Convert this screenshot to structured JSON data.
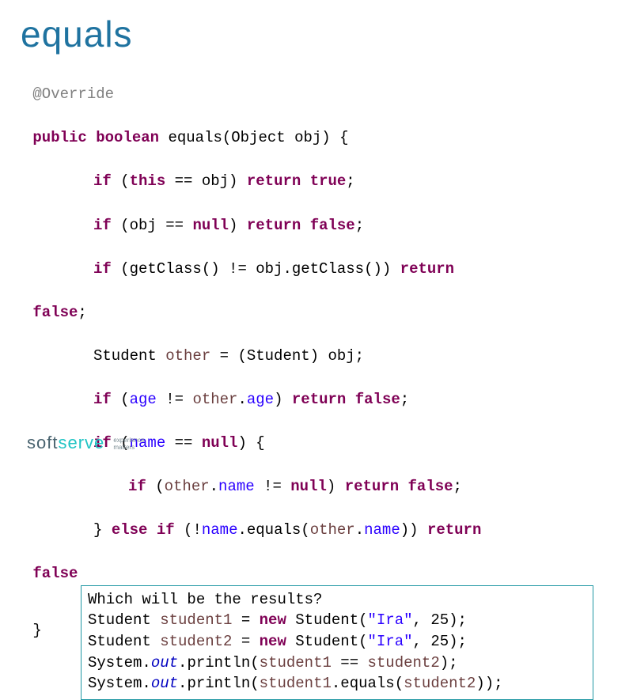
{
  "title": "equals",
  "code": {
    "ann": "@Override",
    "l1a": "public",
    "l1b": "boolean",
    "l1c": "equals(Object obj) {",
    "l2a": "if",
    "l2b": "(",
    "l2c": "this",
    "l2d": " == obj) ",
    "l2e": "return",
    "l2f": "true",
    "l2g": ";",
    "l3a": "if",
    "l3b": " (obj == ",
    "l3c": "null",
    "l3d": ") ",
    "l3e": "return",
    "l3f": "false",
    "l3g": ";",
    "l4a": "if",
    "l4b": " (getClass() != obj.getClass()) ",
    "l4c": "return",
    "l5a": "false",
    "l5b": ";",
    "l6a": "Student ",
    "l6b": "other",
    "l6c": " = (Student) obj;",
    "l7a": "if",
    "l7b": " (",
    "l7c": "age",
    "l7d": " != ",
    "l7e": "other",
    "l7f": ".",
    "l7g": "age",
    "l7h": ") ",
    "l7i": "return",
    "l7j": "false",
    "l7k": ";",
    "l8a": "if",
    "l8b": " (",
    "l8c": "name",
    "l8d": " == ",
    "l8e": "null",
    "l8f": ") {",
    "l9a": "if",
    "l9b": " (",
    "l9c": "other",
    "l9d": ".",
    "l9e": "name",
    "l9f": " != ",
    "l9g": "null",
    "l9h": ") ",
    "l9i": "return",
    "l9j": "false",
    "l9k": ";",
    "l10a": "} ",
    "l10b": "else",
    "l10c": " ",
    "l10d": "if",
    "l10e": " (!",
    "l10f": "name",
    "l10g": ".equals(",
    "l10h": "other",
    "l10i": ".",
    "l10j": "name",
    "l10k": ")) ",
    "l10l": "return",
    "l11a": "false",
    "l12a": "}"
  },
  "question": {
    "q": "Which will be the results?",
    "r1a": "Student ",
    "r1b": "student1",
    "r1c": " = ",
    "r1d": "new",
    "r1e": " Student(",
    "r1f": "\"Ira\"",
    "r1g": ", 25);",
    "r2a": "Student ",
    "r2b": "student2",
    "r2c": " = ",
    "r2d": "new",
    "r2e": " Student(",
    "r2f": "\"Ira\"",
    "r2g": ", 25);",
    "r3a": "System.",
    "r3b": "out",
    "r3c": ".println(",
    "r3d": "student1",
    "r3e": " == ",
    "r3f": "student2",
    "r3g": ");",
    "r4a": "System.",
    "r4b": "out",
    "r4c": ".println(",
    "r4d": "student1",
    "r4e": ".equals(",
    "r4f": "student2",
    "r4g": "));"
  },
  "logo": {
    "soft": "soft",
    "serve": "serve",
    "tag1": "experience",
    "tag2": "matters"
  }
}
